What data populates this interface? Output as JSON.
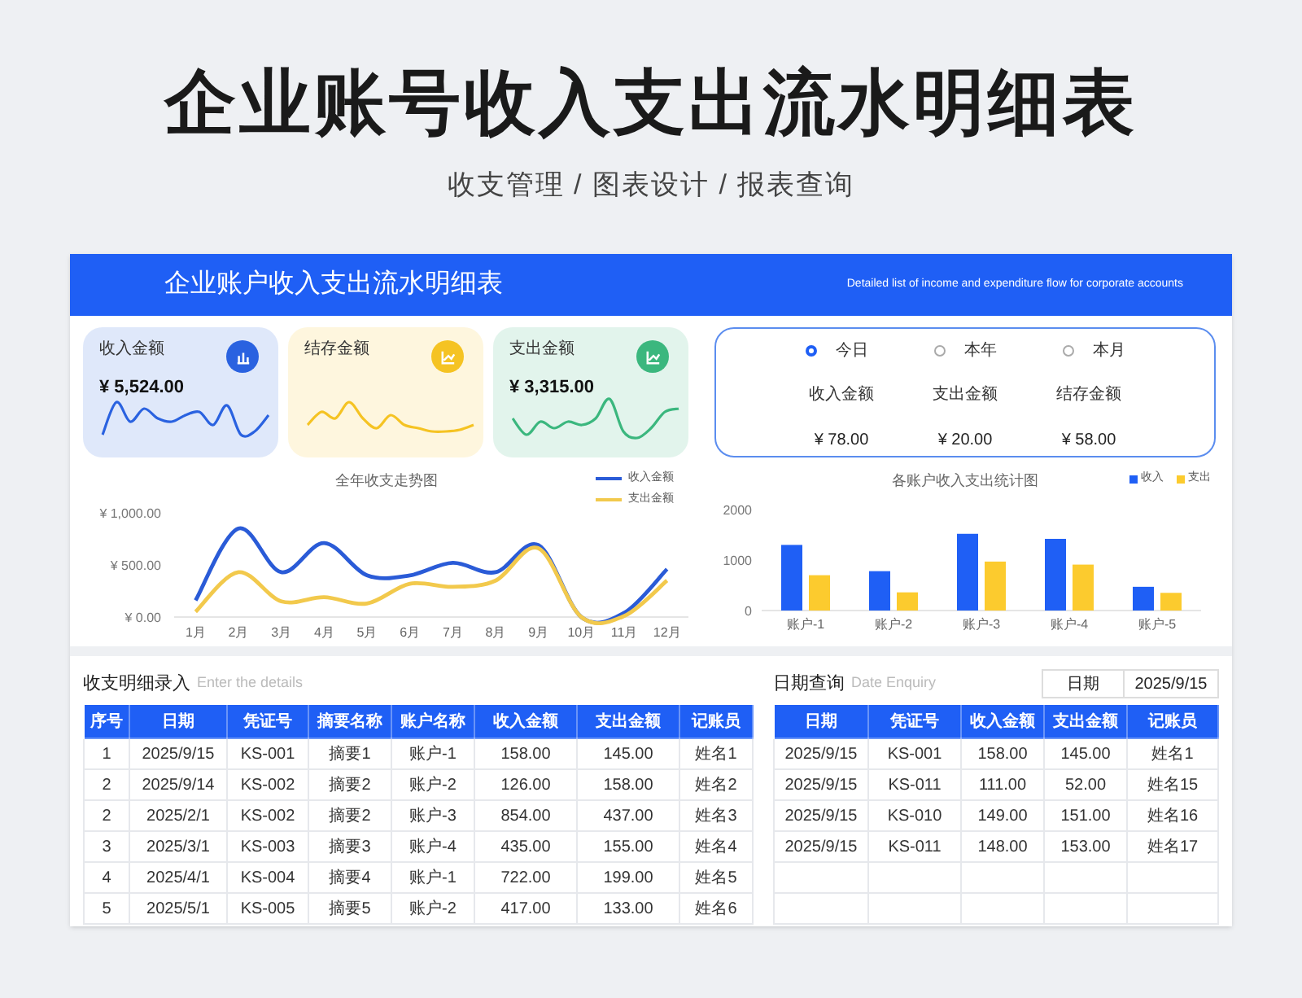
{
  "page_title": "企业账号收入支出流水明细表",
  "subtitle": "收支管理 / 图表设计 / 报表查询",
  "header": {
    "title": "企业账户收入支出流水明细表",
    "subtitle": "Detailed list of income and expenditure flow for corporate accounts"
  },
  "kpi_cards": [
    {
      "label": "收入金额",
      "value": "¥ 5,524.00",
      "color": "#2a62e0"
    },
    {
      "label": "结存金额",
      "color": "#f5c323"
    },
    {
      "label": "支出金额",
      "value": "¥ 3,315.00",
      "color": "#3bb77e"
    }
  ],
  "period_panel": {
    "options": [
      {
        "label": "今日",
        "selected": true
      },
      {
        "label": "本年",
        "selected": false
      },
      {
        "label": "本月",
        "selected": false
      }
    ],
    "stats": [
      {
        "label": "收入金额",
        "value": "¥ 78.00"
      },
      {
        "label": "支出金额",
        "value": "¥ 20.00"
      },
      {
        "label": "结存金额",
        "value": "¥ 58.00"
      }
    ]
  },
  "trend_chart": {
    "chart_data": {
      "type": "line",
      "title": "全年收支走势图",
      "legend": "top-right",
      "categories": [
        "1月",
        "2月",
        "3月",
        "4月",
        "5月",
        "6月",
        "7月",
        "8月",
        "9月",
        "10月",
        "11月",
        "12月"
      ],
      "ylim": [
        0,
        1000
      ],
      "yticks": [
        {
          "value": 0,
          "label": "¥ 0.00"
        },
        {
          "value": 500,
          "label": "¥ 500.00"
        },
        {
          "value": 1000,
          "label": "¥ 1,000.00"
        }
      ],
      "series": [
        {
          "name": "收入金额",
          "color": "#2a5bd7",
          "values": [
            160,
            850,
            430,
            710,
            400,
            400,
            520,
            430,
            690,
            0,
            40,
            460
          ]
        },
        {
          "name": "支出金额",
          "color": "#f2c94c",
          "values": [
            50,
            430,
            150,
            190,
            130,
            320,
            290,
            350,
            660,
            0,
            10,
            350
          ]
        }
      ]
    }
  },
  "account_chart": {
    "chart_data": {
      "type": "bar",
      "title": "各账户收入支出统计图",
      "legend": "top-right",
      "categories": [
        "账户-1",
        "账户-2",
        "账户-3",
        "账户-4",
        "账户-5"
      ],
      "ylim": [
        0,
        2000
      ],
      "yticks": [
        0,
        1000,
        2000
      ],
      "series": [
        {
          "name": "收入",
          "color": "#1f5ff5",
          "values": [
            1300,
            780,
            1520,
            1420,
            470
          ]
        },
        {
          "name": "支出",
          "color": "#fccb2e",
          "values": [
            700,
            360,
            970,
            910,
            350
          ]
        }
      ]
    }
  },
  "entry_table": {
    "title": "收支明细录入",
    "hint": "Enter the details",
    "columns": [
      "序号",
      "日期",
      "凭证号",
      "摘要名称",
      "账户名称",
      "收入金额",
      "支出金额",
      "记账员"
    ],
    "rows": [
      [
        "1",
        "2025/9/15",
        "KS-001",
        "摘要1",
        "账户-1",
        "158.00",
        "145.00",
        "姓名1"
      ],
      [
        "2",
        "2025/9/14",
        "KS-002",
        "摘要2",
        "账户-2",
        "126.00",
        "158.00",
        "姓名2"
      ],
      [
        "2",
        "2025/2/1",
        "KS-002",
        "摘要2",
        "账户-3",
        "854.00",
        "437.00",
        "姓名3"
      ],
      [
        "3",
        "2025/3/1",
        "KS-003",
        "摘要3",
        "账户-4",
        "435.00",
        "155.00",
        "姓名4"
      ],
      [
        "4",
        "2025/4/1",
        "KS-004",
        "摘要4",
        "账户-1",
        "722.00",
        "199.00",
        "姓名5"
      ],
      [
        "5",
        "2025/5/1",
        "KS-005",
        "摘要5",
        "账户-2",
        "417.00",
        "133.00",
        "姓名6"
      ]
    ]
  },
  "query_table": {
    "title": "日期查询",
    "hint": "Date Enquiry",
    "date_label": "日期",
    "date_value": "2025/9/15",
    "columns": [
      "日期",
      "凭证号",
      "收入金额",
      "支出金额",
      "记账员"
    ],
    "rows": [
      [
        "2025/9/15",
        "KS-001",
        "158.00",
        "145.00",
        "姓名1"
      ],
      [
        "2025/9/15",
        "KS-011",
        "111.00",
        "52.00",
        "姓名15"
      ],
      [
        "2025/9/15",
        "KS-010",
        "149.00",
        "151.00",
        "姓名16"
      ],
      [
        "2025/9/15",
        "KS-011",
        "148.00",
        "153.00",
        "姓名17"
      ]
    ]
  }
}
